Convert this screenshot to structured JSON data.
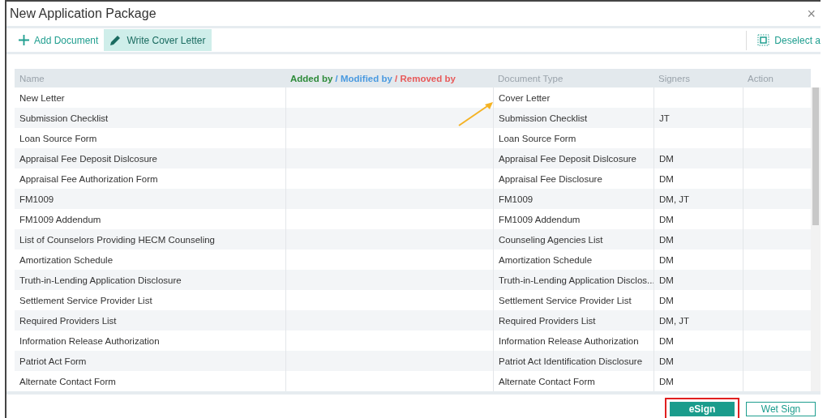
{
  "window": {
    "title": "New Application Package",
    "close": "×"
  },
  "toolbar": {
    "buttons": [
      {
        "label": "Add Document",
        "kind": "add",
        "selected": false
      },
      {
        "label": "Write Cover Letter",
        "kind": "write",
        "selected": true
      }
    ],
    "right_button": {
      "label": "Deselect a"
    }
  },
  "table": {
    "columns": [
      {
        "label": "Name"
      },
      {
        "parts": [
          {
            "text": "Added by",
            "color": "#2e8b3a"
          },
          {
            "text": " / ",
            "color": "#4a9ae0"
          },
          {
            "text": "Modified by",
            "color": "#4a9ae0"
          },
          {
            "text": " / ",
            "color": "#e85a5a"
          },
          {
            "text": "Removed by",
            "color": "#e85a5a"
          }
        ]
      },
      {
        "label": "Document Type"
      },
      {
        "label": "Signers"
      },
      {
        "label": "Action"
      }
    ],
    "rows": [
      {
        "name": "New Letter",
        "type": "Cover Letter",
        "signers": ""
      },
      {
        "name": "Submission Checklist",
        "type": "Submission Checklist",
        "signers": "JT"
      },
      {
        "name": "Loan Source Form",
        "type": "Loan Source Form",
        "signers": ""
      },
      {
        "name": "Appraisal Fee Deposit Dislcosure",
        "type": "Appraisal Fee Deposit Dislcosure",
        "signers": "DM"
      },
      {
        "name": "Appraisal Fee Authorization Form",
        "type": "Appraisal Fee Disclosure",
        "signers": "DM"
      },
      {
        "name": "FM1009",
        "type": "FM1009",
        "signers": "DM, JT"
      },
      {
        "name": "FM1009 Addendum",
        "type": "FM1009 Addendum",
        "signers": "DM"
      },
      {
        "name": "List of Counselors Providing HECM Counseling",
        "type": "Counseling Agencies List",
        "signers": "DM"
      },
      {
        "name": "Amortization Schedule",
        "type": "Amortization Schedule",
        "signers": "DM"
      },
      {
        "name": "Truth-in-Lending Application Disclosure",
        "type": "Truth-in-Lending Application Disclos...",
        "signers": "DM"
      },
      {
        "name": "Settlement Service Provider List",
        "type": "Settlement Service Provider List",
        "signers": "DM"
      },
      {
        "name": "Required Providers List",
        "type": "Required Providers List",
        "signers": "DM, JT"
      },
      {
        "name": "Information Release Authorization",
        "type": "Information Release Authorization",
        "signers": "DM"
      },
      {
        "name": "Patriot Act Form",
        "type": "Patriot Act Identification Disclosure",
        "signers": "DM"
      },
      {
        "name": "Alternate Contact Form",
        "type": "Alternate Contact Form",
        "signers": "DM"
      }
    ]
  },
  "footer": {
    "buttons": [
      {
        "label": "eSign",
        "kind": "primary",
        "highlighted": true
      },
      {
        "label": "Wet Sign",
        "kind": "secondary",
        "highlighted": false
      }
    ]
  }
}
